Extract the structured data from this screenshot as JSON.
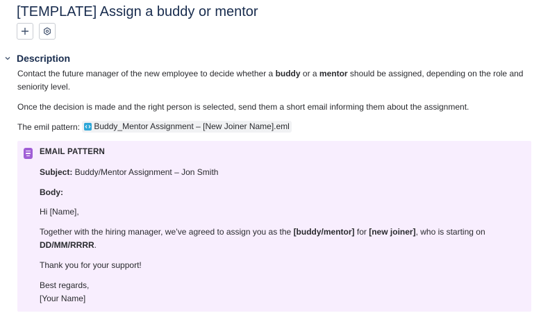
{
  "page": {
    "title": "[TEMPLATE] Assign a buddy or mentor"
  },
  "toolbar": {
    "add_icon": "plus-icon",
    "settings_icon": "hexagon-settings-icon"
  },
  "description": {
    "heading": "Description",
    "p1": {
      "a": "Contact the future manager of the new employee to decide whether a ",
      "b1": "buddy",
      "c": " or a ",
      "b2": "mentor",
      "d": " should be assigned, depending on the role and seniority level."
    },
    "p2": "Once the decision is made and the right person is selected, send them a short email informing them about the assignment.",
    "p3": {
      "label": "The emil pattern: ",
      "file_name": "Buddy_Mentor Assignment – [New Joiner Name].eml",
      "file_icon": "code-file-icon"
    }
  },
  "panel": {
    "icon": "note-icon",
    "background": "#f8eefe",
    "title": "EMAIL PATTERN",
    "subject_label": "Subject:",
    "subject_value": " Buddy/Mentor Assignment – Jon Smith",
    "body_label": "Body:",
    "greeting": "Hi [Name],",
    "line1": {
      "a": "Together with the hiring manager, we’ve agreed to assign you as the ",
      "b1": "[buddy/mentor]",
      "c": " for ",
      "b2": "[new joiner]",
      "d": ", who is starting on ",
      "b3": "DD/MM/RRRR",
      "e": "."
    },
    "thanks": "Thank you for your support!",
    "regards": "Best regards,",
    "signature": "[Your Name]"
  }
}
